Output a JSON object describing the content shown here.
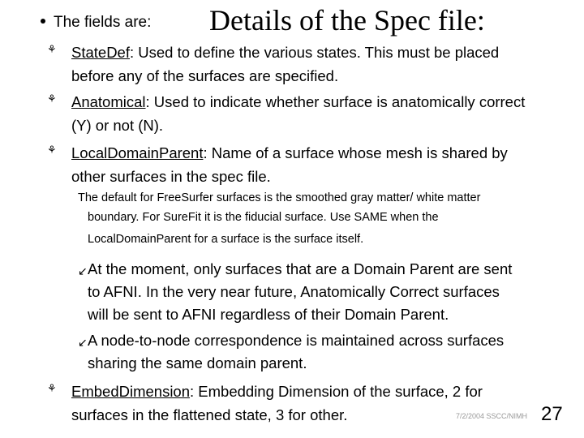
{
  "title": "Details of the Spec file:",
  "intro": "The fields are:",
  "fields": [
    {
      "name": "StateDef",
      "lines": [
        ": Used to define the various states. This must be placed",
        "before any of the surfaces are specified."
      ]
    },
    {
      "name": "Anatomical",
      "lines": [
        ": Used to indicate whether surface is anatomically correct",
        "(Y) or not (N)."
      ]
    },
    {
      "name": "LocalDomainParent",
      "lines": [
        ": Name of a surface whose mesh is shared by",
        "other surfaces in the spec file."
      ]
    },
    {
      "name": "EmbedDimension",
      "lines": [
        ": Embedding Dimension of the surface, 2 for",
        "surfaces in the flattened state, 3 for other."
      ]
    }
  ],
  "note": {
    "lines": [
      "The default for FreeSurfer surfaces is the smoothed gray matter/ white matter",
      "boundary. For SureFit it is the fiducial surface. Use SAME when the",
      "LocalDomainParent for a surface is the surface itself."
    ]
  },
  "subbullets": [
    {
      "lines": [
        "At the moment, only surfaces that are a Domain Parent are sent",
        "to AFNI. In the very near future, Anatomically Correct surfaces",
        "will be sent to AFNI regardless of their Domain Parent."
      ]
    },
    {
      "lines": [
        "A node-to-node correspondence is maintained across surfaces",
        "sharing the same domain parent."
      ]
    }
  ],
  "footer": {
    "date_org": "7/2/2004 SSCC/NIMH",
    "slide_number": "27"
  }
}
